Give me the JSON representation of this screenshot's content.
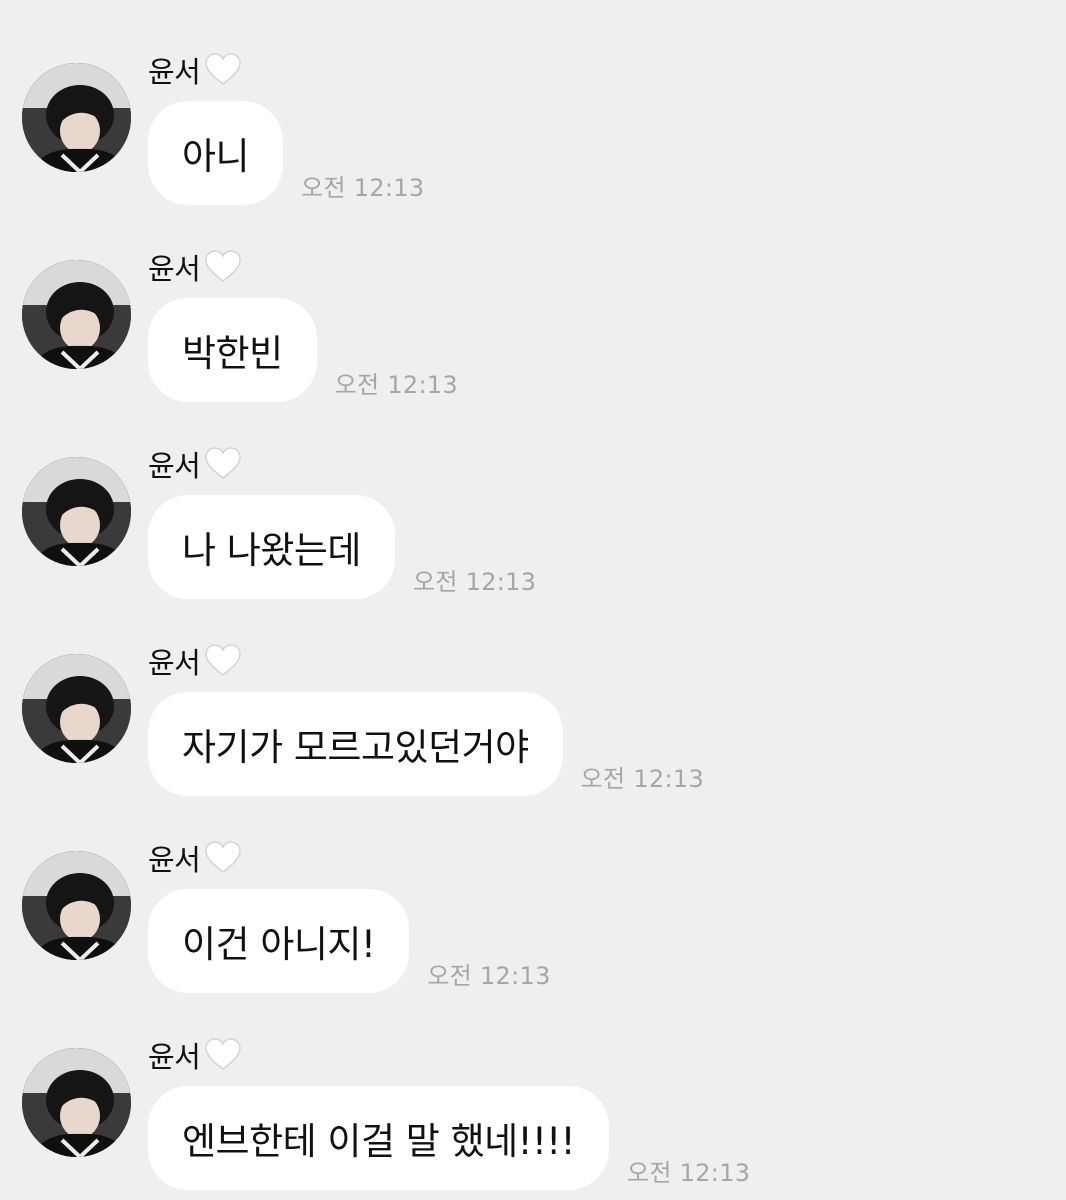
{
  "messages": [
    {
      "sender": "윤서",
      "text": "아니",
      "time": "오전 12:13"
    },
    {
      "sender": "윤서",
      "text": "박한빈",
      "time": "오전 12:13"
    },
    {
      "sender": "윤서",
      "text": "나 나왔는데",
      "time": "오전 12:13"
    },
    {
      "sender": "윤서",
      "text": "자기가 모르고있던거야",
      "time": "오전 12:13"
    },
    {
      "sender": "윤서",
      "text": "이건 아니지!",
      "time": "오전 12:13"
    },
    {
      "sender": "윤서",
      "text": "엔브한테 이걸 말 했네!!!!",
      "time": "오전 12:13"
    }
  ],
  "icons": {
    "sender_badge": "white-heart-icon",
    "avatar": "profile-photo"
  },
  "colors": {
    "background": "#efefef",
    "bubble": "#ffffff",
    "timestamp": "#a6a6a6"
  }
}
